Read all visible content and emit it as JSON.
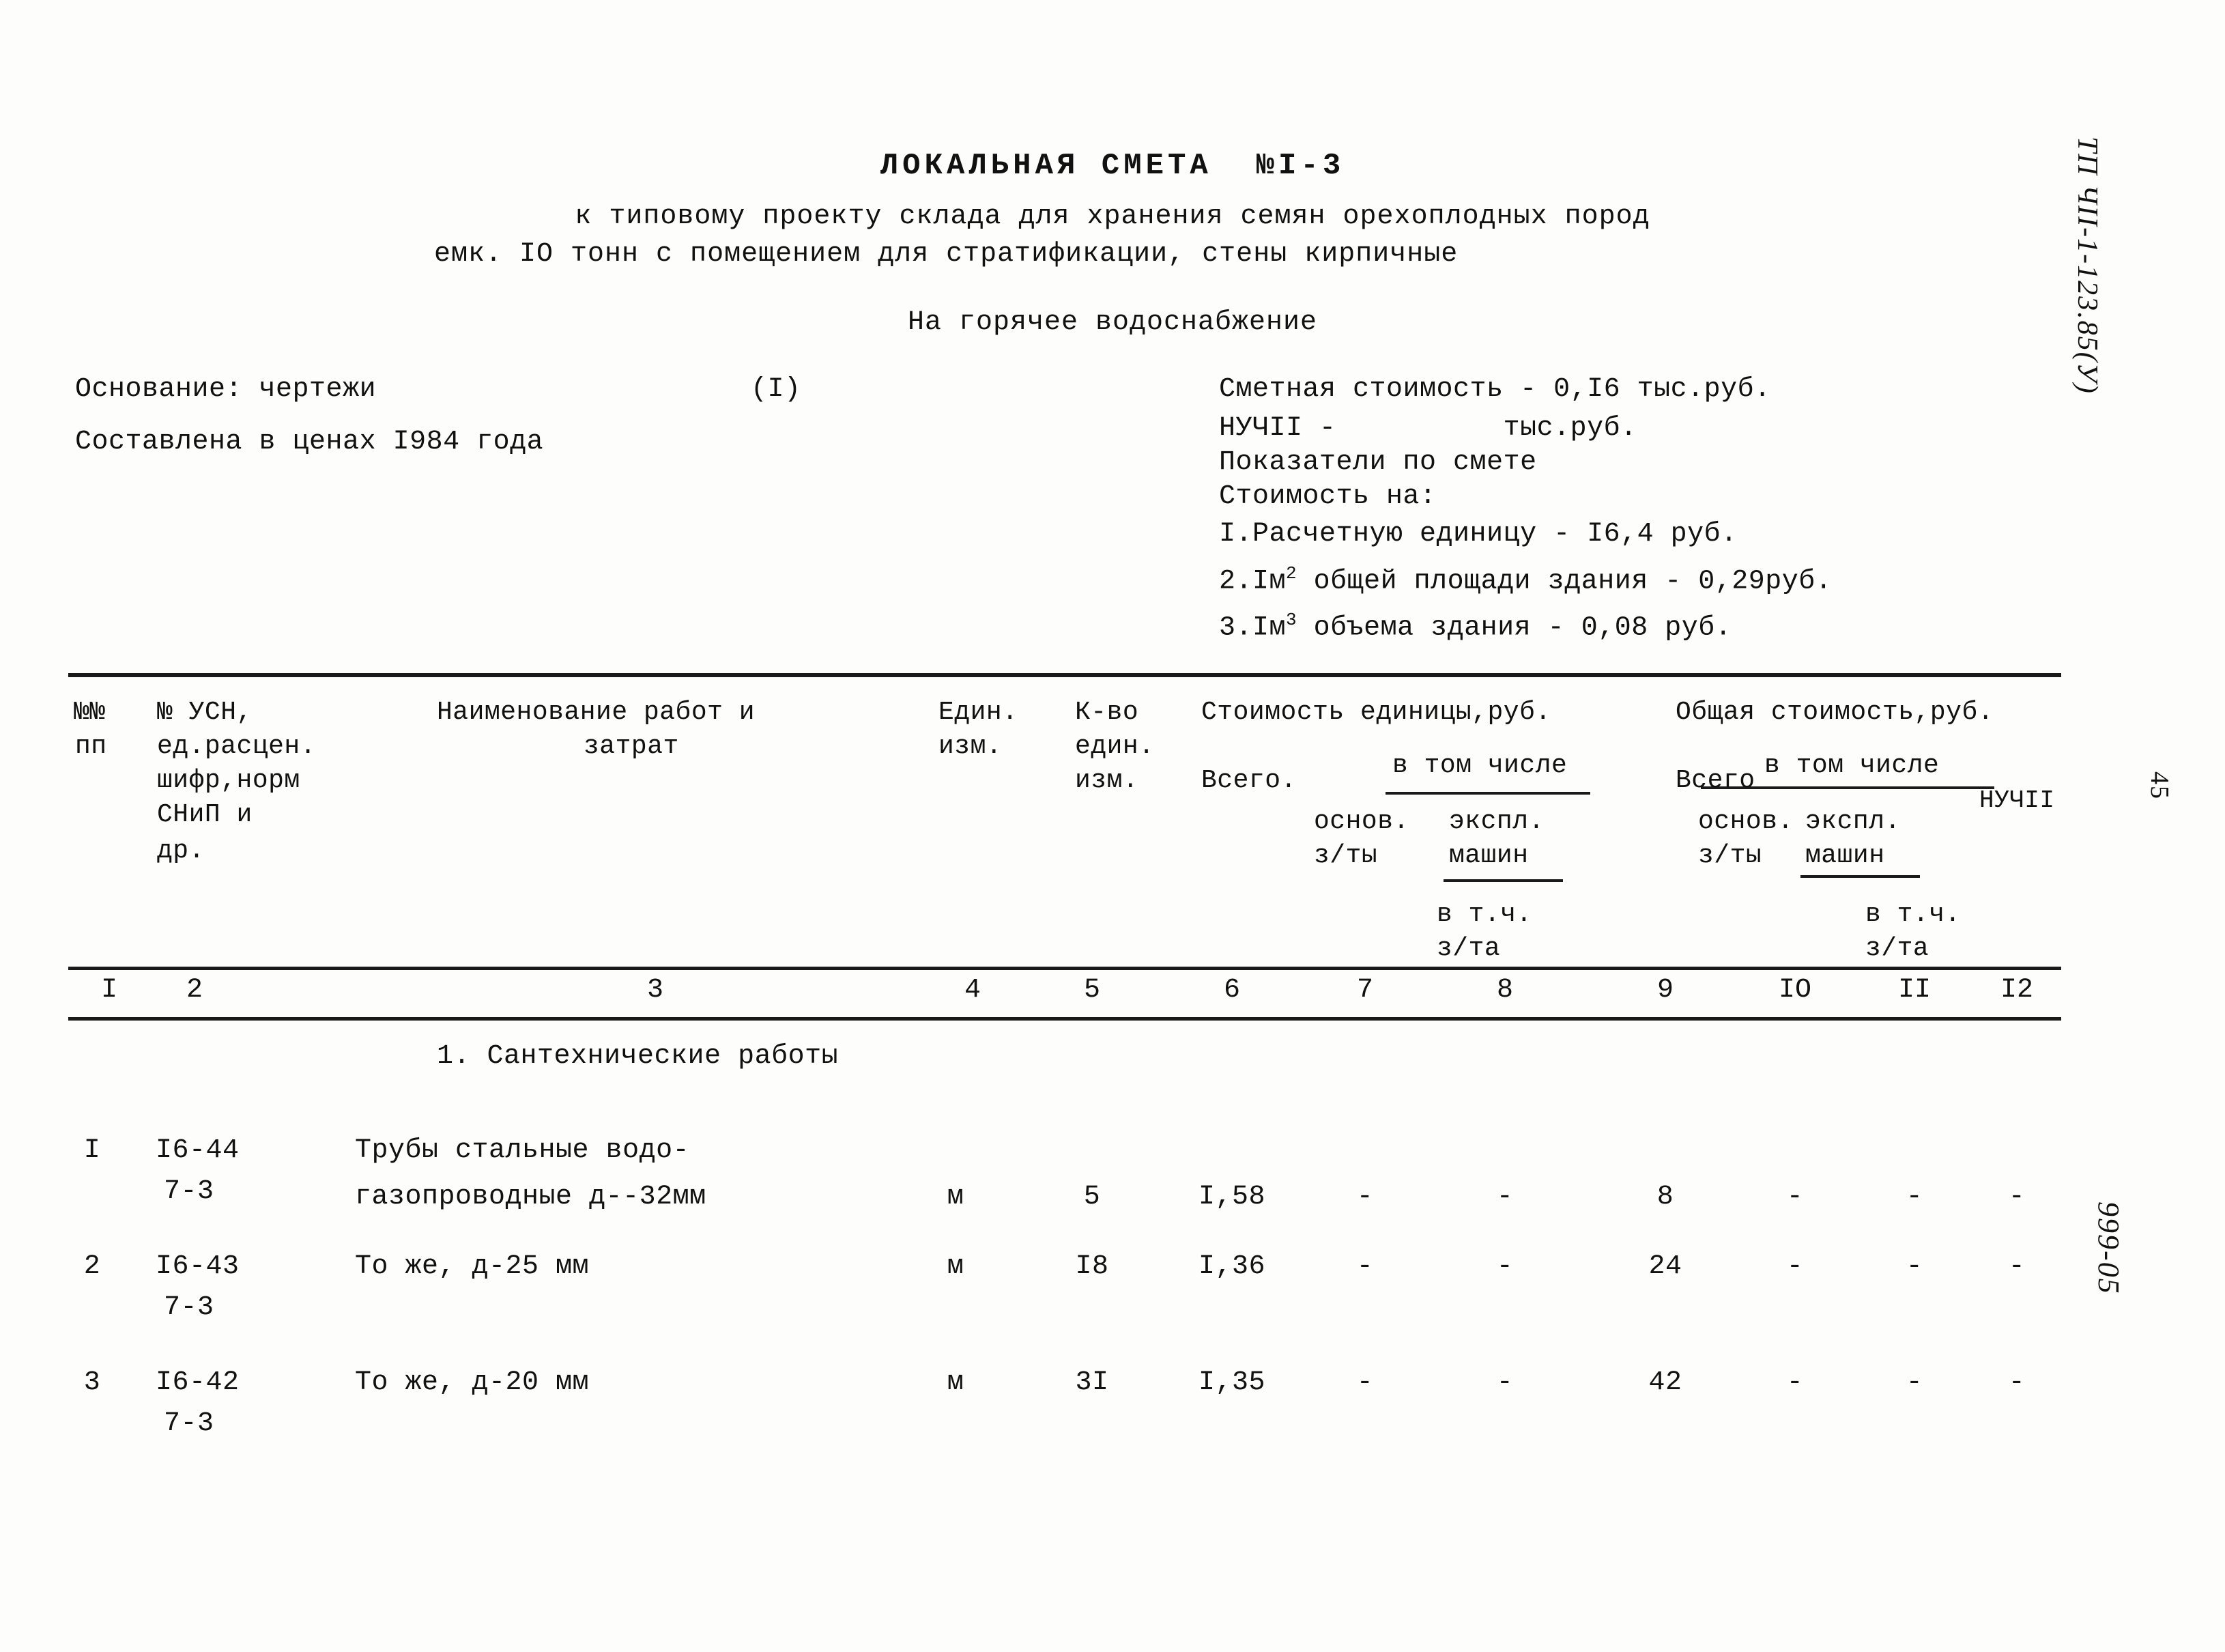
{
  "document": {
    "title": "ЛОКАЛЬНАЯ СМЕТА  №I-3",
    "subtitle_line1": "к типовому проекту склада для хранения семян орехоплодных пород",
    "subtitle_line2": "емк. IО тонн с помещением для стратификации, стены кирпичные",
    "subtitle_line3": "На горячее водоснабжение"
  },
  "basis": {
    "basis_label": "Основание: чертежи",
    "basis_note": "(I)",
    "prices_label": "Составлена в ценах I984 года"
  },
  "summary": {
    "estimate_cost": "Сметная стоимость - 0,I6 тыс.руб.",
    "nuchii": "НУЧII -          тыс.руб.",
    "indicators_label": "Показатели по смете",
    "cost_for_label": "Стоимость на:",
    "item1": "I.Расчетную единицу - I6,4 руб.",
    "item2_pre": "2.Iм",
    "item2_sup": "2",
    "item2_post": " общей площади здания - 0,29руб.",
    "item3_pre": "3.Iм",
    "item3_sup": "3",
    "item3_post": " объема здания - 0,08 руб."
  },
  "table_header": {
    "num_num": "№№",
    "pp": "пп",
    "usn": "№ УСН,",
    "ed_rascen": "ед.расцен.",
    "shifr_norm": "шифр,норм",
    "snip_i": "СНиП и",
    "dr": "др.",
    "naimenovanie": "Наименование работ и",
    "zatrat": "затрат",
    "edin": "Един.",
    "izm": "изм.",
    "kvo": "К-во",
    "edin2": "един.",
    "izm2": "изм.",
    "stoimost_edinicy": "Стоимость единицы,руб.",
    "obshchaya_stoimost": "Общая стоимость,руб.",
    "vsego_1": "Всего.",
    "v_tom_chisle_1": "в том числе",
    "osnov_1": "основ.",
    "ekspl_1": "экспл.",
    "zty_1": "з/ты",
    "mashin_1": "машин",
    "v_tch_1": "в т.ч.",
    "zta_1": "з/та",
    "vsego_2": "Всего",
    "v_tom_chisle_2": "в том числе",
    "osnov_2": "основ.",
    "ekspl_2": "экспл.",
    "zty_2": "з/ты",
    "mashin_2": "машин",
    "v_tch_2": "в т.ч.",
    "zta_2": "з/та",
    "nuchii_col": "НУЧII"
  },
  "column_numbers": [
    "I",
    "2",
    "3",
    "4",
    "5",
    "6",
    "7",
    "8",
    "9",
    "IO",
    "II",
    "I2"
  ],
  "section_heading": "1. Сантехнические работы",
  "rows": [
    {
      "pp": "I",
      "usn_code_line1": "I6-44",
      "usn_code_line2": "7-3",
      "name_line1": "Трубы стальные водо-",
      "name_line2": "газопроводные д--32мм",
      "unit": "м",
      "qty": "5",
      "unit_total": "I,58",
      "unit_osnov": "-",
      "unit_ekspl": "-",
      "total": "8",
      "total_osnov": "-",
      "total_ekspl": "-",
      "nuchii": "-"
    },
    {
      "pp": "2",
      "usn_code_line1": "I6-43",
      "usn_code_line2": "7-3",
      "name_line1": "То же, д-25 мм",
      "name_line2": "",
      "unit": "м",
      "qty": "I8",
      "unit_total": "I,36",
      "unit_osnov": "-",
      "unit_ekspl": "-",
      "total": "24",
      "total_osnov": "-",
      "total_ekspl": "-",
      "nuchii": "-"
    },
    {
      "pp": "3",
      "usn_code_line1": "I6-42",
      "usn_code_line2": "7-3",
      "name_line1": "То же, д-20 мм",
      "name_line2": "",
      "unit": "м",
      "qty": "3I",
      "unit_total": "I,35",
      "unit_osnov": "-",
      "unit_ekspl": "-",
      "total": "42",
      "total_osnov": "-",
      "total_ekspl": "-",
      "nuchii": "-"
    }
  ],
  "margin": {
    "project_code": "ТП ЧII-1-123.85(У)",
    "page_number": "45",
    "bottom_code": "999-05"
  }
}
